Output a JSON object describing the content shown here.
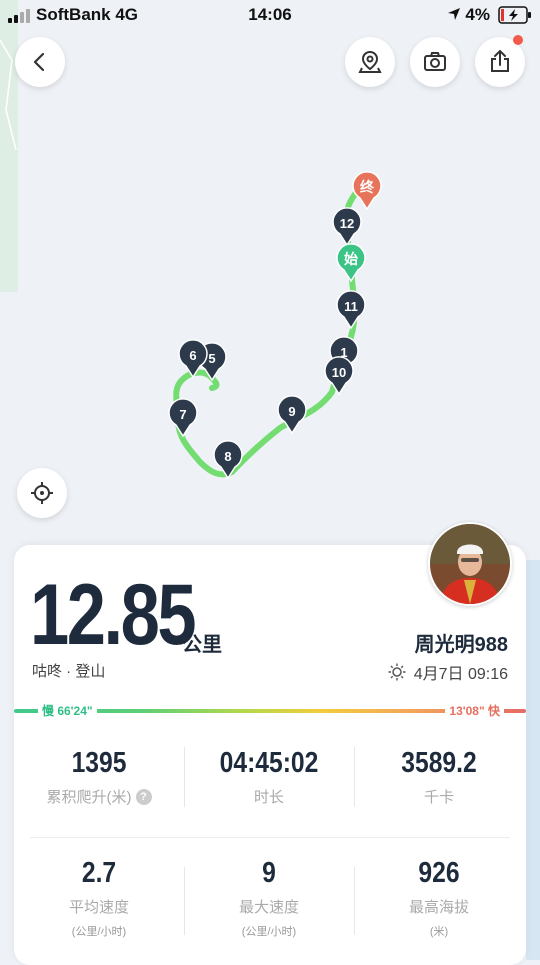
{
  "status_bar": {
    "carrier": "SoftBank 4G",
    "time": "14:06",
    "battery": "4%"
  },
  "map": {
    "markers": [
      "1",
      "5",
      "6",
      "7",
      "8",
      "9",
      "10",
      "11",
      "12"
    ],
    "start_label": "始",
    "end_label": "终",
    "route_color": "#6cdb6a",
    "marker_color": "#2d3a4b"
  },
  "summary": {
    "distance": "12.85",
    "unit": "公里",
    "sport": "咕咚 · 登山",
    "username": "周光明988",
    "date": "4月7日 09:16"
  },
  "pace": {
    "slow": "慢 66'24\"",
    "fast": "13'08\" 快"
  },
  "stats": [
    {
      "value": "1395",
      "label": "累积爬升(米)",
      "help": "?"
    },
    {
      "value": "04:45:02",
      "label": "时长"
    },
    {
      "value": "3589.2",
      "label": "千卡"
    },
    {
      "value": "2.7",
      "label": "平均速度",
      "sub": "(公里/小时)"
    },
    {
      "value": "9",
      "label": "最大速度",
      "sub": "(公里/小时)"
    },
    {
      "value": "926",
      "label": "最高海拔",
      "sub": "(米)"
    }
  ]
}
